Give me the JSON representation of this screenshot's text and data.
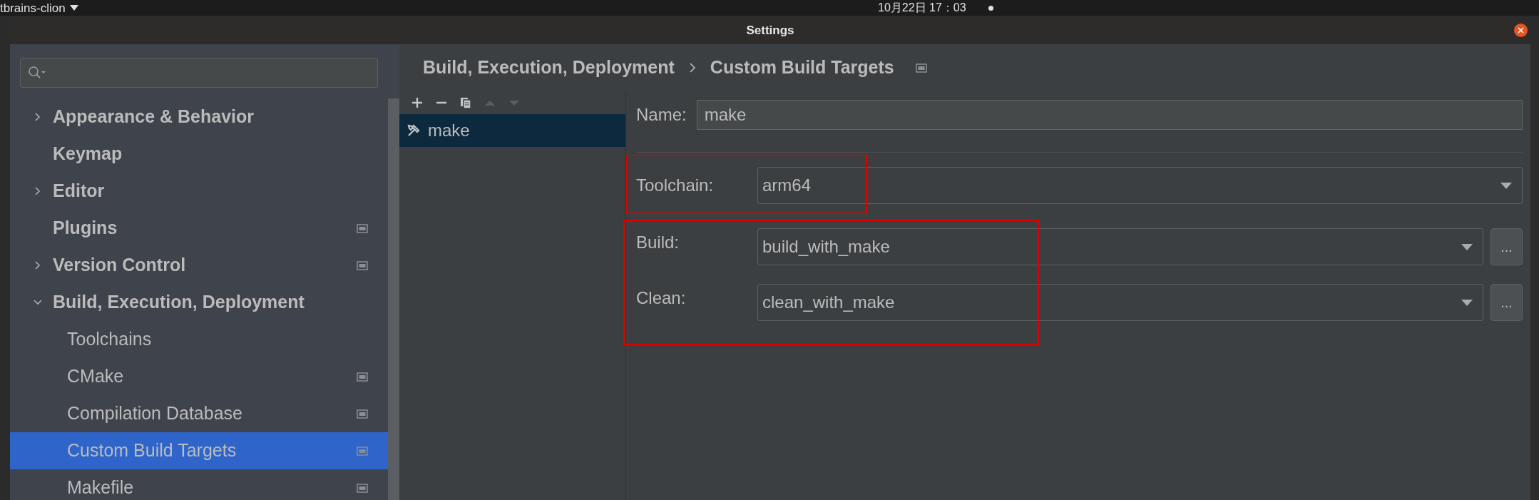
{
  "top_bar": {
    "app_menu": "tbrains-clion",
    "clock": "10月22日 17：03"
  },
  "window": {
    "title": "Settings"
  },
  "sidebar": {
    "items": [
      {
        "label": "Appearance & Behavior",
        "expanded": false,
        "expandable": true,
        "selected": false,
        "project_icon": false
      },
      {
        "label": "Keymap",
        "expandable": false,
        "selected": false,
        "project_icon": false
      },
      {
        "label": "Editor",
        "expanded": false,
        "expandable": true,
        "selected": false,
        "project_icon": false
      },
      {
        "label": "Plugins",
        "expandable": false,
        "selected": false,
        "project_icon": true
      },
      {
        "label": "Version Control",
        "expanded": false,
        "expandable": true,
        "selected": false,
        "project_icon": true
      },
      {
        "label": "Build, Execution, Deployment",
        "expanded": true,
        "expandable": true,
        "selected": false,
        "project_icon": false,
        "children": [
          {
            "label": "Toolchains",
            "selected": false,
            "project_icon": false
          },
          {
            "label": "CMake",
            "selected": false,
            "project_icon": true
          },
          {
            "label": "Compilation Database",
            "selected": false,
            "project_icon": true
          },
          {
            "label": "Custom Build Targets",
            "selected": true,
            "project_icon": true
          },
          {
            "label": "Makefile",
            "selected": false,
            "project_icon": true
          }
        ]
      }
    ]
  },
  "breadcrumb": [
    "Build, Execution, Deployment",
    "Custom Build Targets"
  ],
  "targets": {
    "toolbar": [
      {
        "kind": "add",
        "disabled": false
      },
      {
        "kind": "remove",
        "disabled": false
      },
      {
        "kind": "copy",
        "disabled": false
      },
      {
        "kind": "up",
        "disabled": true
      },
      {
        "kind": "down",
        "disabled": true
      }
    ],
    "items": [
      {
        "label": "make",
        "selected": true
      }
    ]
  },
  "form": {
    "name": {
      "label": "Name:",
      "value": "make"
    },
    "toolchain": {
      "label": "Toolchain:",
      "value": "arm64"
    },
    "build": {
      "label": "Build:",
      "value": "build_with_make",
      "button": "..."
    },
    "clean": {
      "label": "Clean:",
      "value": "clean_with_make",
      "button": "..."
    }
  }
}
